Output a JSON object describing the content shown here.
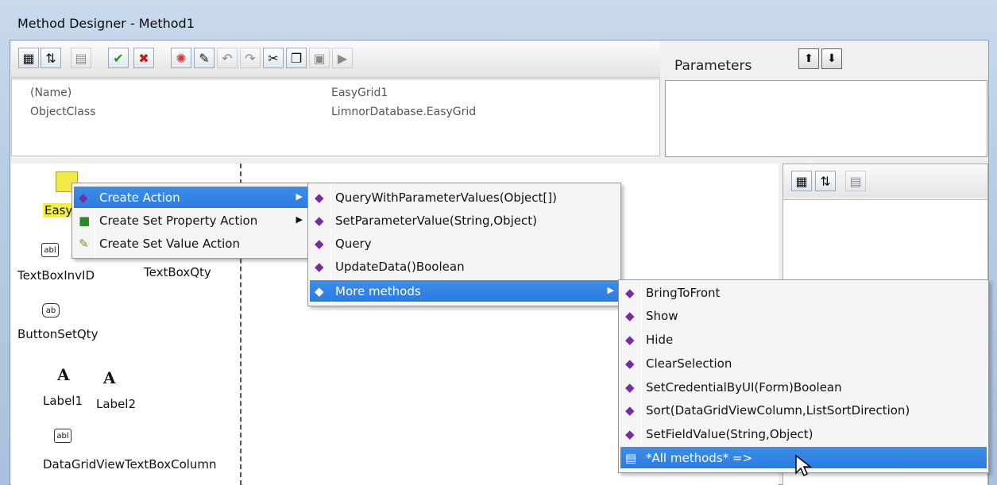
{
  "window": {
    "title": "Method Designer - Method1"
  },
  "toolbar": {
    "icons": [
      "categorized-icon",
      "sort-az-icon",
      "property-pages-icon",
      "accept-icon",
      "cancel-icon",
      "debug-icon",
      "magic-icon",
      "undo-icon",
      "redo-icon",
      "cut-icon",
      "copy-icon",
      "paste-icon",
      "run-icon"
    ]
  },
  "properties": {
    "rows": [
      {
        "name": "(Name)",
        "value": "EasyGrid1"
      },
      {
        "name": "ObjectClass",
        "value": "LimnorDatabase.EasyGrid"
      }
    ]
  },
  "parameters": {
    "title": "Parameters",
    "up_icon": "move-up-icon",
    "down_icon": "move-down-icon"
  },
  "objects": {
    "easygrid_label": "Easy",
    "textbox_inv": "TextBoxInvID",
    "textbox_qty": "TextBoxQty",
    "button_set_qty": "ButtonSetQty",
    "label1": "Label1",
    "label2": "Label2",
    "dgv_column": "DataGridViewTextBoxColumn",
    "textbox_icon_text": "abl",
    "button_icon_text": "ab",
    "label_icon_text": "A"
  },
  "context_menu": {
    "items": [
      {
        "label": "Create Action",
        "has_submenu": true
      },
      {
        "label": "Create Set Property Action",
        "has_submenu": true
      },
      {
        "label": "Create Set Value Action",
        "has_submenu": false
      }
    ]
  },
  "action_menu": {
    "items": [
      {
        "label": "QueryWithParameterValues(Object[])"
      },
      {
        "label": "SetParameterValue(String,Object)"
      },
      {
        "label": "Query"
      },
      {
        "label": "UpdateData()Boolean"
      },
      {
        "label": "More methods",
        "has_submenu": true
      }
    ]
  },
  "more_methods_menu": {
    "items": [
      {
        "label": "BringToFront"
      },
      {
        "label": "Show"
      },
      {
        "label": "Hide"
      },
      {
        "label": "ClearSelection"
      },
      {
        "label": "SetCredentialByUI(Form)Boolean"
      },
      {
        "label": "Sort(DataGridViewColumn,ListSortDirection)"
      },
      {
        "label": "SetFieldValue(String,Object)"
      },
      {
        "label": "*All methods* =>"
      }
    ]
  },
  "colors": {
    "highlight": "#3484e4",
    "window_chrome": "#b7cbe4"
  }
}
